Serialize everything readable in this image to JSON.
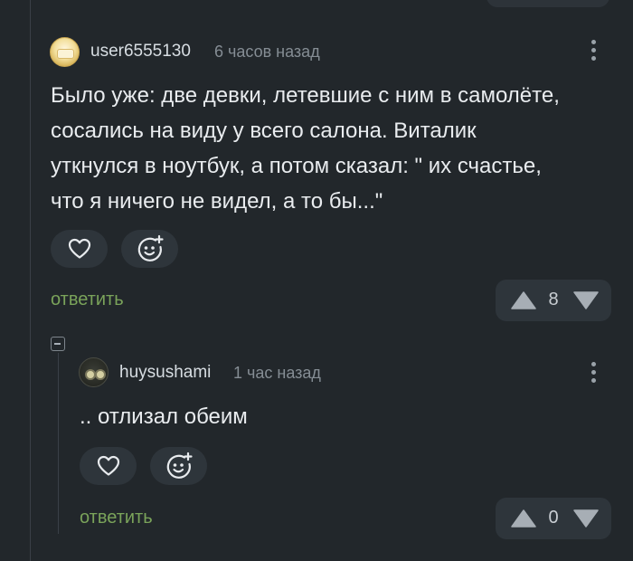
{
  "colors": {
    "background": "#22272b",
    "button_background": "#2e353b",
    "reply_link": "#7aa35a",
    "meta_text": "#858d94"
  },
  "comments": [
    {
      "username": "user6555130",
      "time": "6 часов назад",
      "text_lines": [
        "Было уже: две девки, летевшие с ним в самолёте,",
        "сосались на виду у всего салона. Виталик",
        "уткнулся в ноутбук, а потом сказал: \" их счастье,",
        "что я ничего не видел, а то бы...\""
      ],
      "reply_label": "ответить",
      "rating": "8",
      "icons": [
        "heart-icon",
        "emoji-add-icon",
        "arrow-up-icon",
        "arrow-down-icon",
        "more-vertical-icon"
      ]
    },
    {
      "username": "huysushami",
      "time": "1 час назад",
      "text_lines": [
        ".. отлизал обеим"
      ],
      "reply_label": "ответить",
      "rating": "0",
      "icons": [
        "heart-icon",
        "emoji-add-icon",
        "arrow-up-icon",
        "arrow-down-icon",
        "more-vertical-icon"
      ]
    }
  ]
}
